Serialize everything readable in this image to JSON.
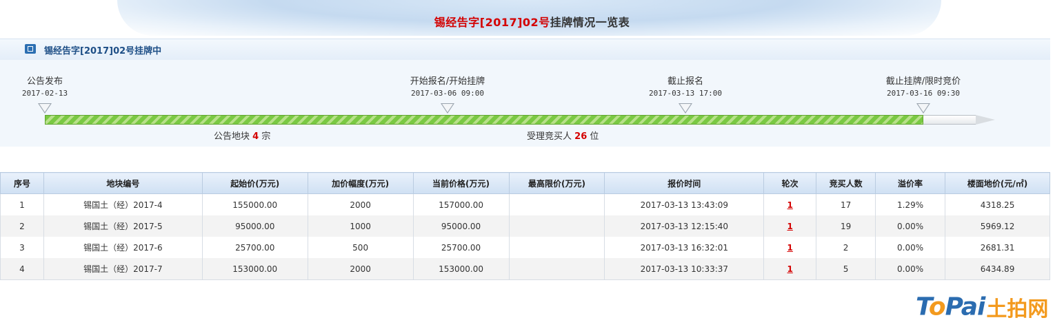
{
  "header": {
    "title_highlight": "锡经告字[2017]02号",
    "title_rest": "挂牌情况一览表"
  },
  "status": {
    "icon": "document-icon",
    "text": "锡经告字[2017]02号挂牌中"
  },
  "timeline": {
    "stages": [
      {
        "name": "公告发布",
        "date": "2017-02-13"
      },
      {
        "name": "开始报名/开始挂牌",
        "date": "2017-03-06 09:00"
      },
      {
        "name": "截止报名",
        "date": "2017-03-13 17:00"
      },
      {
        "name": "截止挂牌/限时竞价",
        "date": "2017-03-16 09:30"
      }
    ],
    "stats": [
      {
        "prefix": "公告地块",
        "value": "4",
        "suffix": "宗"
      },
      {
        "prefix": "受理竞买人",
        "value": "26",
        "suffix": "位"
      }
    ],
    "colors": {
      "progress": "#7ac943",
      "accent": "#d40000"
    }
  },
  "table": {
    "headers": [
      "序号",
      "地块编号",
      "起始价(万元)",
      "加价幅度(万元)",
      "当前价格(万元)",
      "最高限价(万元)",
      "报价时间",
      "轮次",
      "竞买人数",
      "溢价率",
      "楼面地价(元/㎡)"
    ],
    "rows": [
      [
        "1",
        "锡国土（经）2017-4",
        "155000.00",
        "2000",
        "157000.00",
        "",
        "2017-03-13 13:43:09",
        "1",
        "17",
        "1.29%",
        "4318.25"
      ],
      [
        "2",
        "锡国土（经）2017-5",
        "95000.00",
        "1000",
        "95000.00",
        "",
        "2017-03-13 12:15:40",
        "1",
        "19",
        "0.00%",
        "5969.12"
      ],
      [
        "3",
        "锡国土（经）2017-6",
        "25700.00",
        "500",
        "25700.00",
        "",
        "2017-03-13 16:32:01",
        "1",
        "2",
        "0.00%",
        "2681.31"
      ],
      [
        "4",
        "锡国土（经）2017-7",
        "153000.00",
        "2000",
        "153000.00",
        "",
        "2017-03-13 10:33:37",
        "1",
        "5",
        "0.00%",
        "6434.89"
      ]
    ]
  },
  "watermark": {
    "latin_a": "T",
    "latin_b": "o",
    "latin_c": "Pai",
    "cn": "土拍网"
  }
}
